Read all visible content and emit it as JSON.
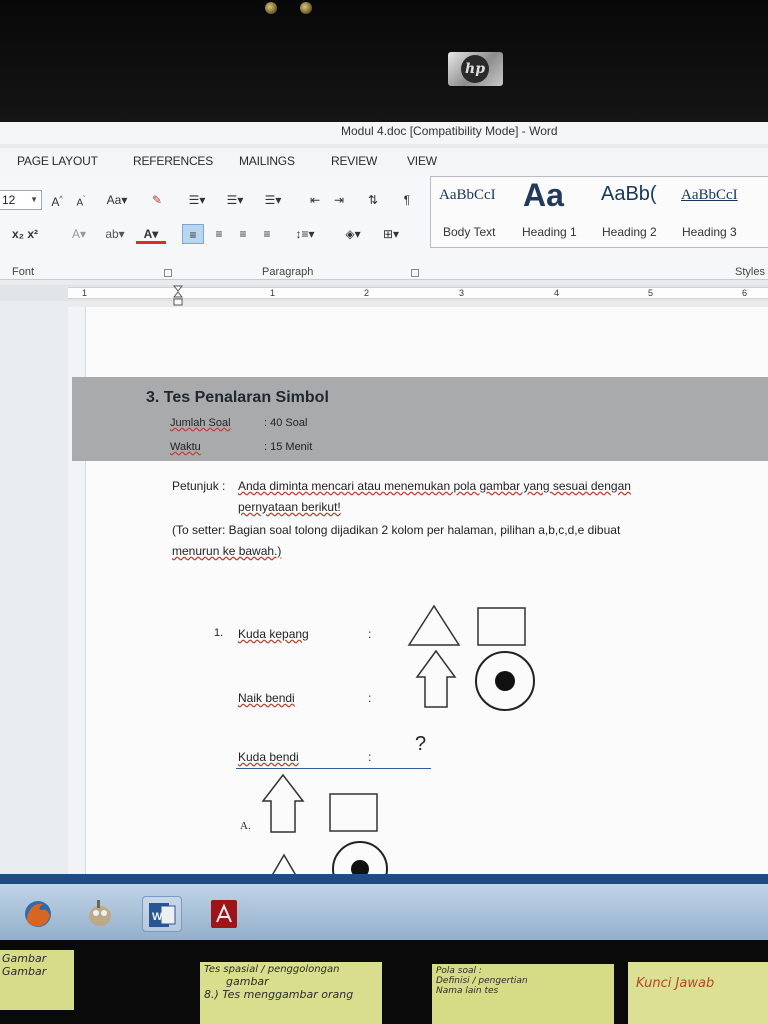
{
  "window": {
    "title": "Modul 4.doc [Compatibility Mode] - Word"
  },
  "tabs": [
    "PAGE LAYOUT",
    "REFERENCES",
    "MAILINGS",
    "REVIEW",
    "VIEW"
  ],
  "ribbon": {
    "font_size": "12",
    "group_labels": {
      "font": "Font",
      "paragraph": "Paragraph",
      "styles": "Styles"
    },
    "styles": [
      {
        "preview": "AaBbCcI",
        "name": "Body Text"
      },
      {
        "preview": "Aa",
        "name": "Heading 1"
      },
      {
        "preview": "AaBb(",
        "name": "Heading 2"
      },
      {
        "preview": "AaBbCcI",
        "name": "Heading 3"
      }
    ]
  },
  "ruler": {
    "numbers": [
      "1",
      "1",
      "2",
      "3",
      "4",
      "5",
      "6"
    ]
  },
  "document": {
    "heading": "3. Tes Penalaran Simbol",
    "jumlah_label": "Jumlah Soal",
    "jumlah_value": ": 40 Soal",
    "waktu_label": "Waktu",
    "waktu_value": ": 15 Menit",
    "petunjuk_label": "Petunjuk :",
    "petunjuk_line1": "Anda diminta mencari atau menemukan pola gambar yang sesuai dengan",
    "petunjuk_line2": "pernyataan berikut!",
    "setter_line1": "(To setter: Bagian soal tolong dijadikan 2 kolom per halaman, pilihan a,b,c,d,e dibuat",
    "setter_line2": "menurun ke bawah.)",
    "question_number": "1.",
    "q_line1": "Kuda kepang",
    "q_line2": "Naik bendi",
    "q_line3": "Kuda bendi",
    "colon": ":",
    "question_mark": "?",
    "option_a": "A."
  },
  "taskbar": {
    "apps": [
      "firefox-icon",
      "gimp-icon",
      "word-icon",
      "acrobat-icon"
    ]
  },
  "notes": {
    "note1": [
      "Gambar",
      "Gambar"
    ],
    "note2": [
      "Tes spasial / penggolongan",
      "gambar",
      "8.) Tes menggambar orang"
    ],
    "note3": [
      "Pola soal :",
      "Definisi / pengertian",
      "Nama lain tes"
    ],
    "note4": [
      "Kunci Jawab"
    ]
  },
  "colors": {
    "taskbar": "#1d4e84",
    "heading_gray": "#a9aaab",
    "red_text": "#c62828"
  }
}
